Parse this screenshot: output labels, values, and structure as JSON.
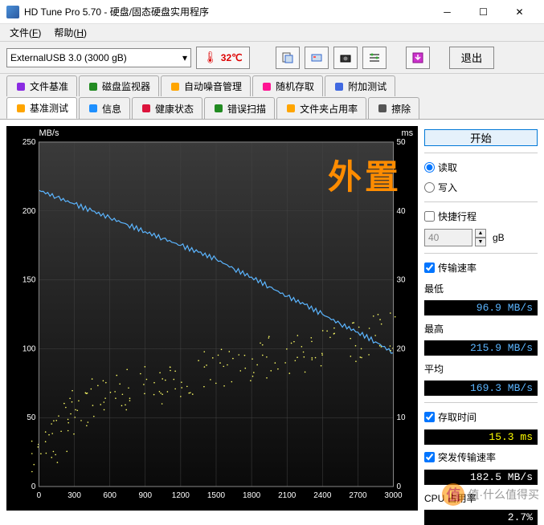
{
  "window": {
    "title": "HD Tune Pro 5.70 - 硬盘/固态硬盘实用程序"
  },
  "menu": {
    "file": "文件",
    "file_key": "F",
    "help": "帮助",
    "help_key": "H"
  },
  "toolbar": {
    "drive": "ExternalUSB 3.0 (3000 gB)",
    "temp": "32℃",
    "exit": "退出"
  },
  "tabs_row1": [
    {
      "label": "文件基准",
      "icon": "doc",
      "color": "#8a2be2"
    },
    {
      "label": "磁盘监视器",
      "icon": "monitor",
      "color": "#228b22"
    },
    {
      "label": "自动噪音管理",
      "icon": "speaker",
      "color": "#ffa500"
    },
    {
      "label": "随机存取",
      "icon": "random",
      "color": "#ff1493"
    },
    {
      "label": "附加测试",
      "icon": "extra",
      "color": "#4169e1"
    }
  ],
  "tabs_row2": [
    {
      "label": "基准测试",
      "icon": "bench",
      "color": "#ffa500",
      "active": true
    },
    {
      "label": "信息",
      "icon": "info",
      "color": "#1e90ff"
    },
    {
      "label": "健康状态",
      "icon": "health",
      "color": "#dc143c"
    },
    {
      "label": "错误扫描",
      "icon": "scan",
      "color": "#228b22"
    },
    {
      "label": "文件夹占用率",
      "icon": "folder",
      "color": "#ffa500"
    },
    {
      "label": "擦除",
      "icon": "erase",
      "color": "#555"
    }
  ],
  "side": {
    "start": "开始",
    "read": "读取",
    "write": "写入",
    "short_stroke": "快捷行程",
    "stroke_val": "40",
    "stroke_unit": "gB",
    "transfer_rate": "传输速率",
    "min_label": "最低",
    "min_val": "96.9 MB/s",
    "max_label": "最高",
    "max_val": "215.9 MB/s",
    "avg_label": "平均",
    "avg_val": "169.3 MB/s",
    "access_time": "存取时间",
    "access_val": "15.3 ms",
    "burst": "突发传输速率",
    "burst_val": "182.5 MB/s",
    "cpu": "CPU 占用率",
    "cpu_val": "2.7%"
  },
  "overlay": "外置",
  "watermark": "值·什么值得买",
  "chart_data": {
    "type": "line",
    "title": "",
    "xlabel": "",
    "ylabel_left": "MB/s",
    "ylabel_right": "ms",
    "xlim": [
      0,
      3000
    ],
    "ylim_left": [
      0,
      250
    ],
    "ylim_right": [
      0,
      50
    ],
    "xticks": [
      0,
      300,
      600,
      900,
      1200,
      1500,
      1800,
      2100,
      2400,
      2700,
      3000
    ],
    "yticks_left": [
      0,
      50,
      100,
      150,
      200,
      250
    ],
    "yticks_right": [
      0,
      10,
      20,
      30,
      40,
      50
    ],
    "series": [
      {
        "name": "transfer_rate",
        "type": "line",
        "color": "#5bb5ff",
        "axis": "left",
        "x": [
          0,
          150,
          300,
          450,
          600,
          750,
          900,
          1050,
          1200,
          1350,
          1500,
          1650,
          1800,
          1950,
          2100,
          2250,
          2400,
          2550,
          2700,
          2850,
          3000
        ],
        "y": [
          215,
          210,
          205,
          200,
          195,
          190,
          185,
          180,
          175,
          170,
          165,
          158,
          152,
          145,
          138,
          132,
          125,
          118,
          112,
          105,
          97
        ]
      },
      {
        "name": "access_time",
        "type": "scatter",
        "color": "#ffff66",
        "axis": "right",
        "x": [
          20,
          60,
          100,
          150,
          200,
          260,
          320,
          380,
          450,
          520,
          600,
          680,
          760,
          850,
          940,
          1030,
          1120,
          1210,
          1300,
          1400,
          1500,
          1600,
          1700,
          1800,
          1900,
          2000,
          2100,
          2200,
          2300,
          2400,
          2500,
          2600,
          2700,
          2800,
          2900,
          2980
        ],
        "y": [
          5,
          6,
          7,
          8,
          9,
          10,
          11,
          12,
          12,
          13,
          13,
          14,
          14,
          15,
          15,
          15,
          16,
          16,
          16,
          17,
          17,
          17,
          18,
          18,
          18,
          19,
          19,
          19,
          20,
          20,
          20,
          21,
          21,
          22,
          22,
          23
        ]
      }
    ]
  }
}
